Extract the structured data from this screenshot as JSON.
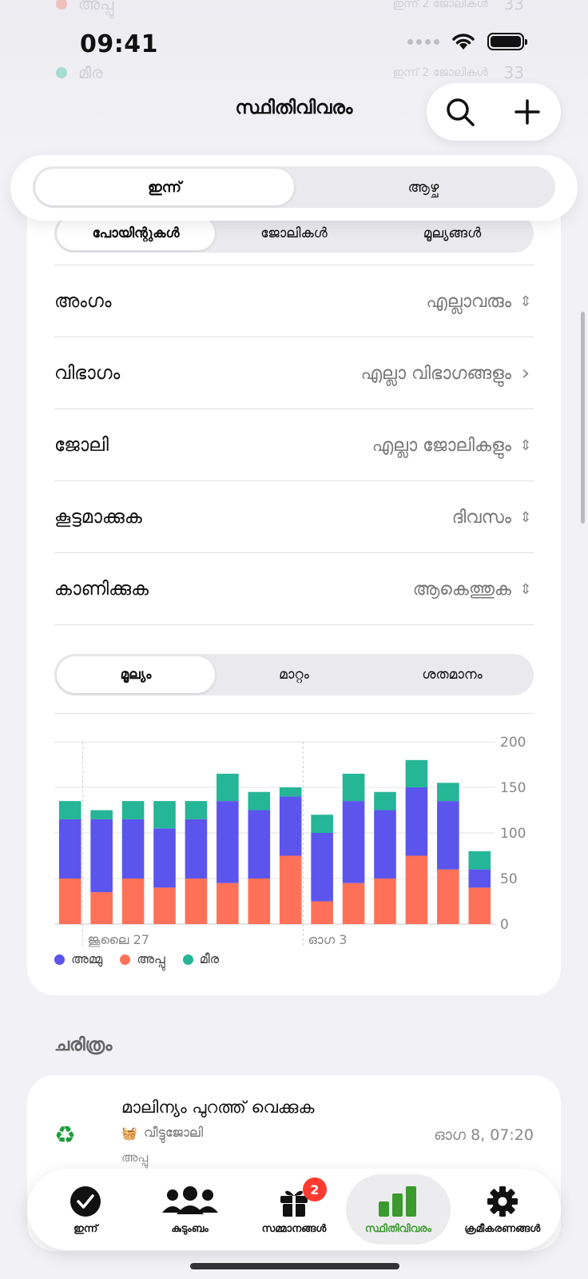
{
  "status": {
    "time": "09:41"
  },
  "nav": {
    "title": "സ്ഥിതിവിവരം"
  },
  "range_tabs": [
    {
      "label": "ഇന്ന്",
      "selected": true
    },
    {
      "label": "ആഴ്ച",
      "selected": false
    }
  ],
  "metric_tabs": [
    {
      "label": "പോയിന്റുകൾ",
      "selected": true
    },
    {
      "label": "ജോലികൾ",
      "selected": false
    },
    {
      "label": "മൂല്യങ്ങൾ",
      "selected": false
    }
  ],
  "filters": [
    {
      "label": "അംഗം",
      "value": "എല്ലാവരും",
      "chevron": "⌃⌄"
    },
    {
      "label": "വിഭാഗം",
      "value": "എല്ലാ വിഭാഗങ്ങളും",
      "chevron": "›"
    },
    {
      "label": "ജോലി",
      "value": "എല്ലാ ജോലികളും",
      "chevron": "⌃⌄"
    },
    {
      "label": "കൂട്ടമാക്കുക",
      "value": "ദിവസം",
      "chevron": "⌃⌄"
    },
    {
      "label": "കാണിക്കുക",
      "value": "ആകെത്തുക",
      "chevron": "⌃⌄"
    }
  ],
  "value_tabs": [
    {
      "label": "മൂല്യം",
      "selected": true
    },
    {
      "label": "മാറ്റം",
      "selected": false
    },
    {
      "label": "ശതമാനം",
      "selected": false
    }
  ],
  "chart_data": {
    "type": "bar",
    "stacked": true,
    "title": "",
    "xlabel": "",
    "ylabel": "",
    "ylim": [
      0,
      200
    ],
    "yticks": [
      0,
      50,
      100,
      150,
      200
    ],
    "x_tick_labels": [
      {
        "index": 1,
        "label": "ജൂലൈ 27"
      },
      {
        "index": 8,
        "label": "ഓഗ 3"
      }
    ],
    "grid": true,
    "legend": "bottom-left",
    "series": [
      {
        "name": "അപ്പു",
        "color": "#ff7158",
        "values": [
          50,
          35,
          50,
          40,
          50,
          45,
          50,
          75,
          25,
          45,
          50,
          75,
          60,
          40
        ]
      },
      {
        "name": "അമ്മു",
        "color": "#5b55ee",
        "values": [
          65,
          80,
          65,
          65,
          65,
          90,
          75,
          65,
          75,
          90,
          75,
          75,
          75,
          20
        ]
      },
      {
        "name": "മീര",
        "color": "#25b597",
        "values": [
          20,
          10,
          20,
          30,
          20,
          30,
          20,
          10,
          20,
          30,
          20,
          30,
          20,
          20
        ]
      }
    ]
  },
  "legend_items": [
    {
      "name": "അമ്മു",
      "color": "#5b55ee"
    },
    {
      "name": "അപ്പു",
      "color": "#ff7158"
    },
    {
      "name": "മീര",
      "color": "#25b597"
    }
  ],
  "history": {
    "title": "ചരിത്രം",
    "items": [
      {
        "icon": "♻",
        "name": "മാലിന്യം പുറത്ത് വെക്കുക",
        "category": "വീട്ടുജോലി",
        "category_icon": "🧺",
        "member": "അപ്പു",
        "time": "ഓഗ 8, 07:20"
      }
    ]
  },
  "ghost": [
    {
      "name": "അപ്പു",
      "sub": "ഇന്ന് 2 ജോലികൾ",
      "points": "33",
      "color": "#ff7158"
    },
    {
      "name": "മീര",
      "sub": "ഇന്ന് 2 ജോലികൾ",
      "points": "33",
      "color": "#25b597"
    }
  ],
  "tabbar": [
    {
      "label": "ഇന്ന്",
      "icon": "check-circle-icon",
      "selected": false
    },
    {
      "label": "കുടുംബം",
      "icon": "people-icon",
      "selected": false
    },
    {
      "label": "സമ്മാനങ്ങൾ",
      "icon": "gift-icon",
      "selected": false,
      "badge": "2"
    },
    {
      "label": "സ്ഥിതിവിവരം",
      "icon": "bar-chart-icon",
      "selected": true
    },
    {
      "label": "ക്രമീകരണങ്ങൾ",
      "icon": "gear-icon",
      "selected": false
    }
  ]
}
